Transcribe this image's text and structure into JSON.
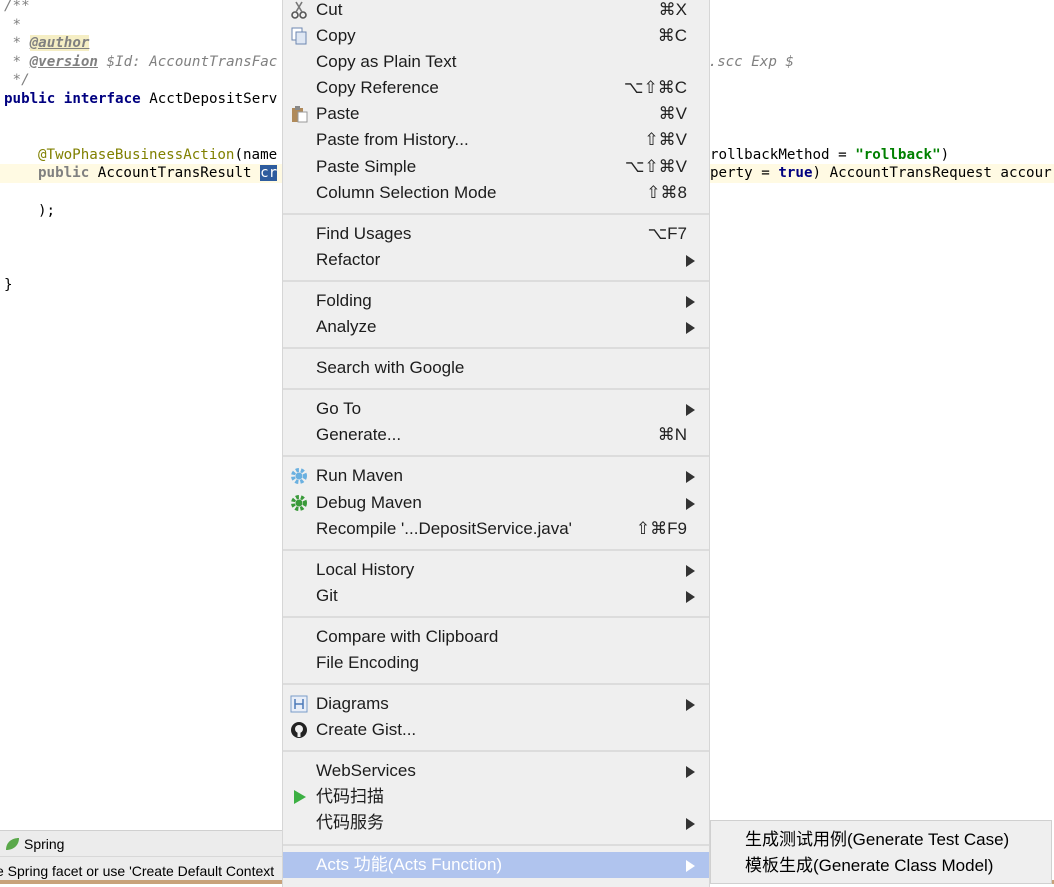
{
  "editor": {
    "lines": {
      "l1": "/**",
      "l2": " *",
      "l3_star": " * ",
      "l3_tag": "@author",
      "l4_star": " * ",
      "l4_tag": "@version",
      "l4_rest": " $Id: AccountTransFac",
      "l4_tail": "o.scc Exp $",
      "l5": " */",
      "l6_kw1": "public",
      "l6_kw2": "interface",
      "l6_rest": " AcctDepositServ",
      "l9_ann": "@TwoPhaseBusinessAction",
      "l9_rest": "(name",
      "l9_tail": "rollbackMethod = ",
      "l9_str": "\"rollback\"",
      "l9_end": ")",
      "l10_kw": "public",
      "l10_rest": " AccountTransResult ",
      "l10_sel": "cr",
      "l10_tail": "perty = ",
      "l10_true": "true",
      "l10_end": ") AccountTransRequest accour",
      "l12": ");",
      "l16": "}"
    }
  },
  "toolbar": {
    "spring_label": "Spring",
    "icon": "spring-leaf-icon"
  },
  "status": {
    "text": "e Spring facet or use 'Create Default Context"
  },
  "context_menu": {
    "groups": [
      [
        {
          "label": "Cut",
          "shortcut": "⌘X",
          "icon": "scissors-icon"
        },
        {
          "label": "Copy",
          "shortcut": "⌘C",
          "icon": "copy-icon"
        },
        {
          "label": "Copy as Plain Text",
          "shortcut": ""
        },
        {
          "label": "Copy Reference",
          "shortcut": "⌥⇧⌘C"
        },
        {
          "label": "Paste",
          "shortcut": "⌘V",
          "icon": "paste-icon"
        },
        {
          "label": "Paste from History...",
          "shortcut": "⇧⌘V"
        },
        {
          "label": "Paste Simple",
          "shortcut": "⌥⇧⌘V"
        },
        {
          "label": "Column Selection Mode",
          "shortcut": "⇧⌘8"
        }
      ],
      [
        {
          "label": "Find Usages",
          "shortcut": "⌥F7"
        },
        {
          "label": "Refactor",
          "submenu": true
        }
      ],
      [
        {
          "label": "Folding",
          "submenu": true
        },
        {
          "label": "Analyze",
          "submenu": true
        }
      ],
      [
        {
          "label": "Search with Google"
        }
      ],
      [
        {
          "label": "Go To",
          "submenu": true
        },
        {
          "label": "Generate...",
          "shortcut": "⌘N"
        }
      ],
      [
        {
          "label": "Run Maven",
          "submenu": true,
          "icon": "gear-icon"
        },
        {
          "label": "Debug Maven",
          "submenu": true,
          "icon": "gear-debug-icon"
        },
        {
          "label": "Recompile '...DepositService.java'",
          "shortcut": "⇧⌘F9"
        }
      ],
      [
        {
          "label": "Local History",
          "submenu": true
        },
        {
          "label": "Git",
          "submenu": true
        }
      ],
      [
        {
          "label": "Compare with Clipboard"
        },
        {
          "label": "File Encoding"
        }
      ],
      [
        {
          "label": "Diagrams",
          "submenu": true,
          "icon": "diagram-icon"
        },
        {
          "label": "Create Gist...",
          "icon": "github-icon"
        }
      ],
      [
        {
          "label": "WebServices",
          "submenu": true
        },
        {
          "label": "代码扫描",
          "icon": "play-icon"
        },
        {
          "label": "代码服务",
          "submenu": true
        }
      ],
      [
        {
          "label": "Acts 功能(Acts Function)",
          "submenu": true,
          "highlighted": true
        }
      ]
    ]
  },
  "submenu": {
    "items": [
      {
        "label": "生成测试用例(Generate Test Case)"
      },
      {
        "label": "模板生成(Generate Class Model)"
      }
    ]
  },
  "colors": {
    "highlight": "#b0c4ee",
    "selection": "#2e5c9e",
    "menu_bg": "#efefef"
  }
}
